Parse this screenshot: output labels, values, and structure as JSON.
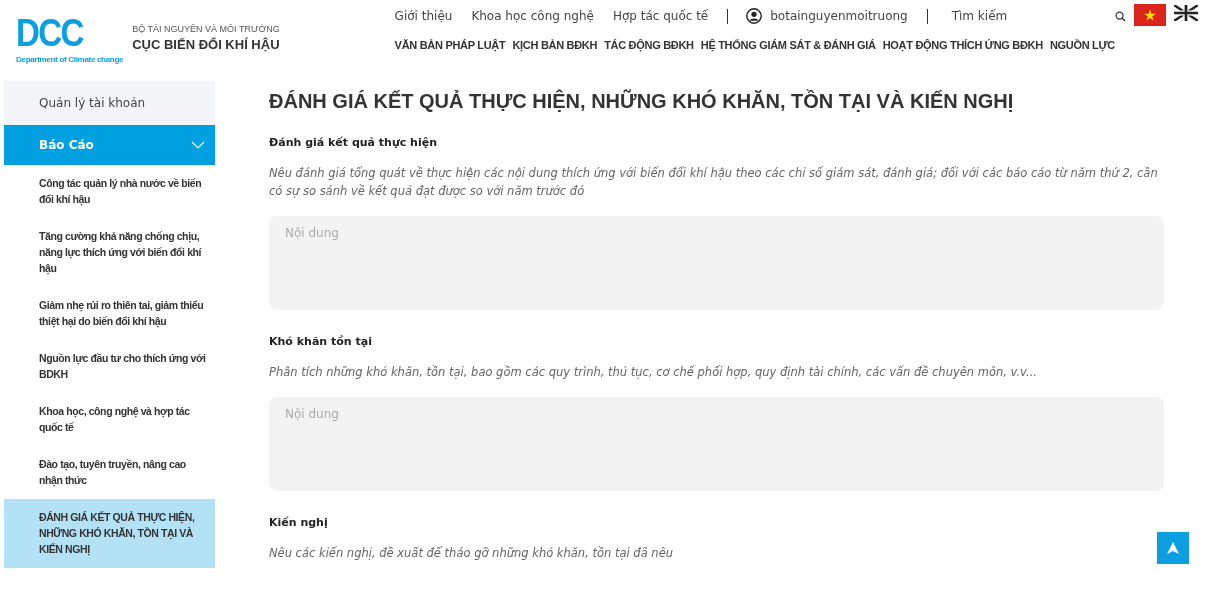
{
  "logo": {
    "mark": "DCC",
    "tagline": "Department of Climate change",
    "ministry": "BỘ TÀI NGUYÊN VÀ MÔI TRƯỜNG",
    "agency": "CỤC BIẾN ĐỔI KHÍ HẬU"
  },
  "top_links": [
    "Giới thiệu",
    "Khoa học công nghệ",
    "Hợp tác quốc tế"
  ],
  "user": {
    "name": "botainguyenmoitruong"
  },
  "search_link": "Tìm kiếm",
  "languages": [
    {
      "kind": "vn",
      "selected": true
    },
    {
      "kind": "uk",
      "selected": false
    }
  ],
  "main_nav": [
    "VĂN BẢN PHÁP LUẬT",
    "KỊCH BẢN BĐKH",
    "TÁC ĐỘNG BĐKH",
    "HỆ THỐNG GIÁM SÁT & ĐÁNH GIÁ",
    "HOẠT ĐỘNG THÍCH ỨNG BĐKH",
    "NGUỒN LỰC"
  ],
  "sidebar": {
    "account": "Quản lý tài khoản",
    "section": {
      "label": "Báo Cáo",
      "expanded": true,
      "items": [
        {
          "label": "Công tác quản lý nhà nước về biến đổi khí hậu",
          "selected": false
        },
        {
          "label": "Tăng cường khả năng chống chịu, năng lực thích ứng với biến đổi khí hậu",
          "selected": false
        },
        {
          "label": "Giảm nhẹ rủi ro thiên tai, giảm thiểu thiệt hại do biến đổi khí hậu",
          "selected": false
        },
        {
          "label": "Nguồn lực đầu tư cho thích ứng với BDKH",
          "selected": false
        },
        {
          "label": "Khoa học, công nghệ và hợp tác quốc tế",
          "selected": false
        },
        {
          "label": "Đào tạo, tuyên truyền, nâng cao nhận thức",
          "selected": false
        },
        {
          "label": "ĐÁNH GIÁ KẾT QUẢ THỰC HIỆN, NHỮNG KHÓ KHĂN, TỒN TẠI VÀ KIẾN NGHỊ",
          "selected": true
        }
      ]
    }
  },
  "page_title": "ĐÁNH GIÁ KẾT QUẢ THỰC HIỆN, NHỮNG KHÓ KHĂN, TỒN TẠI VÀ KIẾN NGHỊ",
  "sections": [
    {
      "label": "Đánh giá kết quả thực hiện",
      "hint": "Nêu đánh giá tổng quát về thực hiện các nội dung thích ứng với biến đổi khí hậu theo các chỉ số giám sát, đánh giá; đối với các báo cáo từ năm thứ 2, cần có sự so sánh về kết quả đạt được so với năm trước đó",
      "placeholder": "Nội dung"
    },
    {
      "label": "Khó khăn tồn tại",
      "hint": "Phân tích những khó khăn, tồn tại, bao gồm các quy trình, thủ tục, cơ chế phối hợp, quy định tài chính, các vấn đề chuyên môn, v.v...",
      "placeholder": "Nội dung"
    },
    {
      "label": "Kiến nghị",
      "hint": "Nêu các kiến nghị, đề xuất để tháo gỡ những khó khăn, tồn tại đã nêu"
    }
  ]
}
